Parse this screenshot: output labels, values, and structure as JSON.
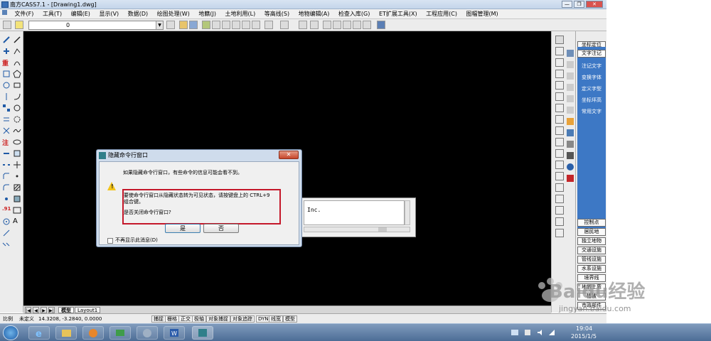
{
  "titlebar": {
    "title": "南方CASS7.1 - [Drawing1.dwg]",
    "min": "—",
    "restore": "❐",
    "close": "✕"
  },
  "menu": {
    "items": [
      "文件(F)",
      "工具(T)",
      "编辑(E)",
      "显示(V)",
      "数据(D)",
      "绘图处理(W)",
      "地籍(J)",
      "土地利用(L)",
      "等高线(S)",
      "地物编辑(A)",
      "检查入库(G)",
      "ET扩展工具(X)",
      "工程应用(C)",
      "图幅管理(M)"
    ]
  },
  "toolbar": {
    "layer_value": "0"
  },
  "bottom_tabs": {
    "model": "模型",
    "layout": "Layout1"
  },
  "right_panel": {
    "top": "坐标定位",
    "selected": "文字注记",
    "links": [
      "注记文字",
      "变换字体",
      "定义字型",
      "坐标坪高",
      "常用文字"
    ],
    "buttons": [
      "控制点",
      "居民地",
      "独立地物",
      "交通设施",
      "管线设施",
      "水系设施",
      "境界线",
      "地貌土质",
      "植被",
      "市政部件"
    ]
  },
  "cmd": {
    "text": "Inc."
  },
  "dialog": {
    "title": "隐藏命令行窗口",
    "line1": "如果隐藏命令行窗口，有些命令的信息可能会看不到。",
    "line2a": "要使命令行窗口从隐藏状态转为可见状态，请按键盘上的 CTRL+9",
    "line2b": "组合键。",
    "question": "是否关闭命令行窗口?",
    "yes": "是",
    "no": "否",
    "checkbox": "不再显示此消息(D)"
  },
  "status": {
    "scale_label": "比例",
    "scale_value": "未定义",
    "coords": "14.3208,  -3.2840,  0.0000",
    "buttons": [
      "捕捉",
      "栅格",
      "正交",
      "极轴",
      "对象捕捉",
      "对象追踪",
      "DYN",
      "线宽",
      "模型"
    ]
  },
  "taskbar": {
    "time": "19:04",
    "date": "2015/1/5"
  },
  "watermark": {
    "brand": "Baidu经验",
    "url": "jingyan.baidu.com"
  },
  "colors": {
    "canvas": "#000000",
    "panel_blue": "#3d78c5",
    "highlight": "#c4182a"
  }
}
